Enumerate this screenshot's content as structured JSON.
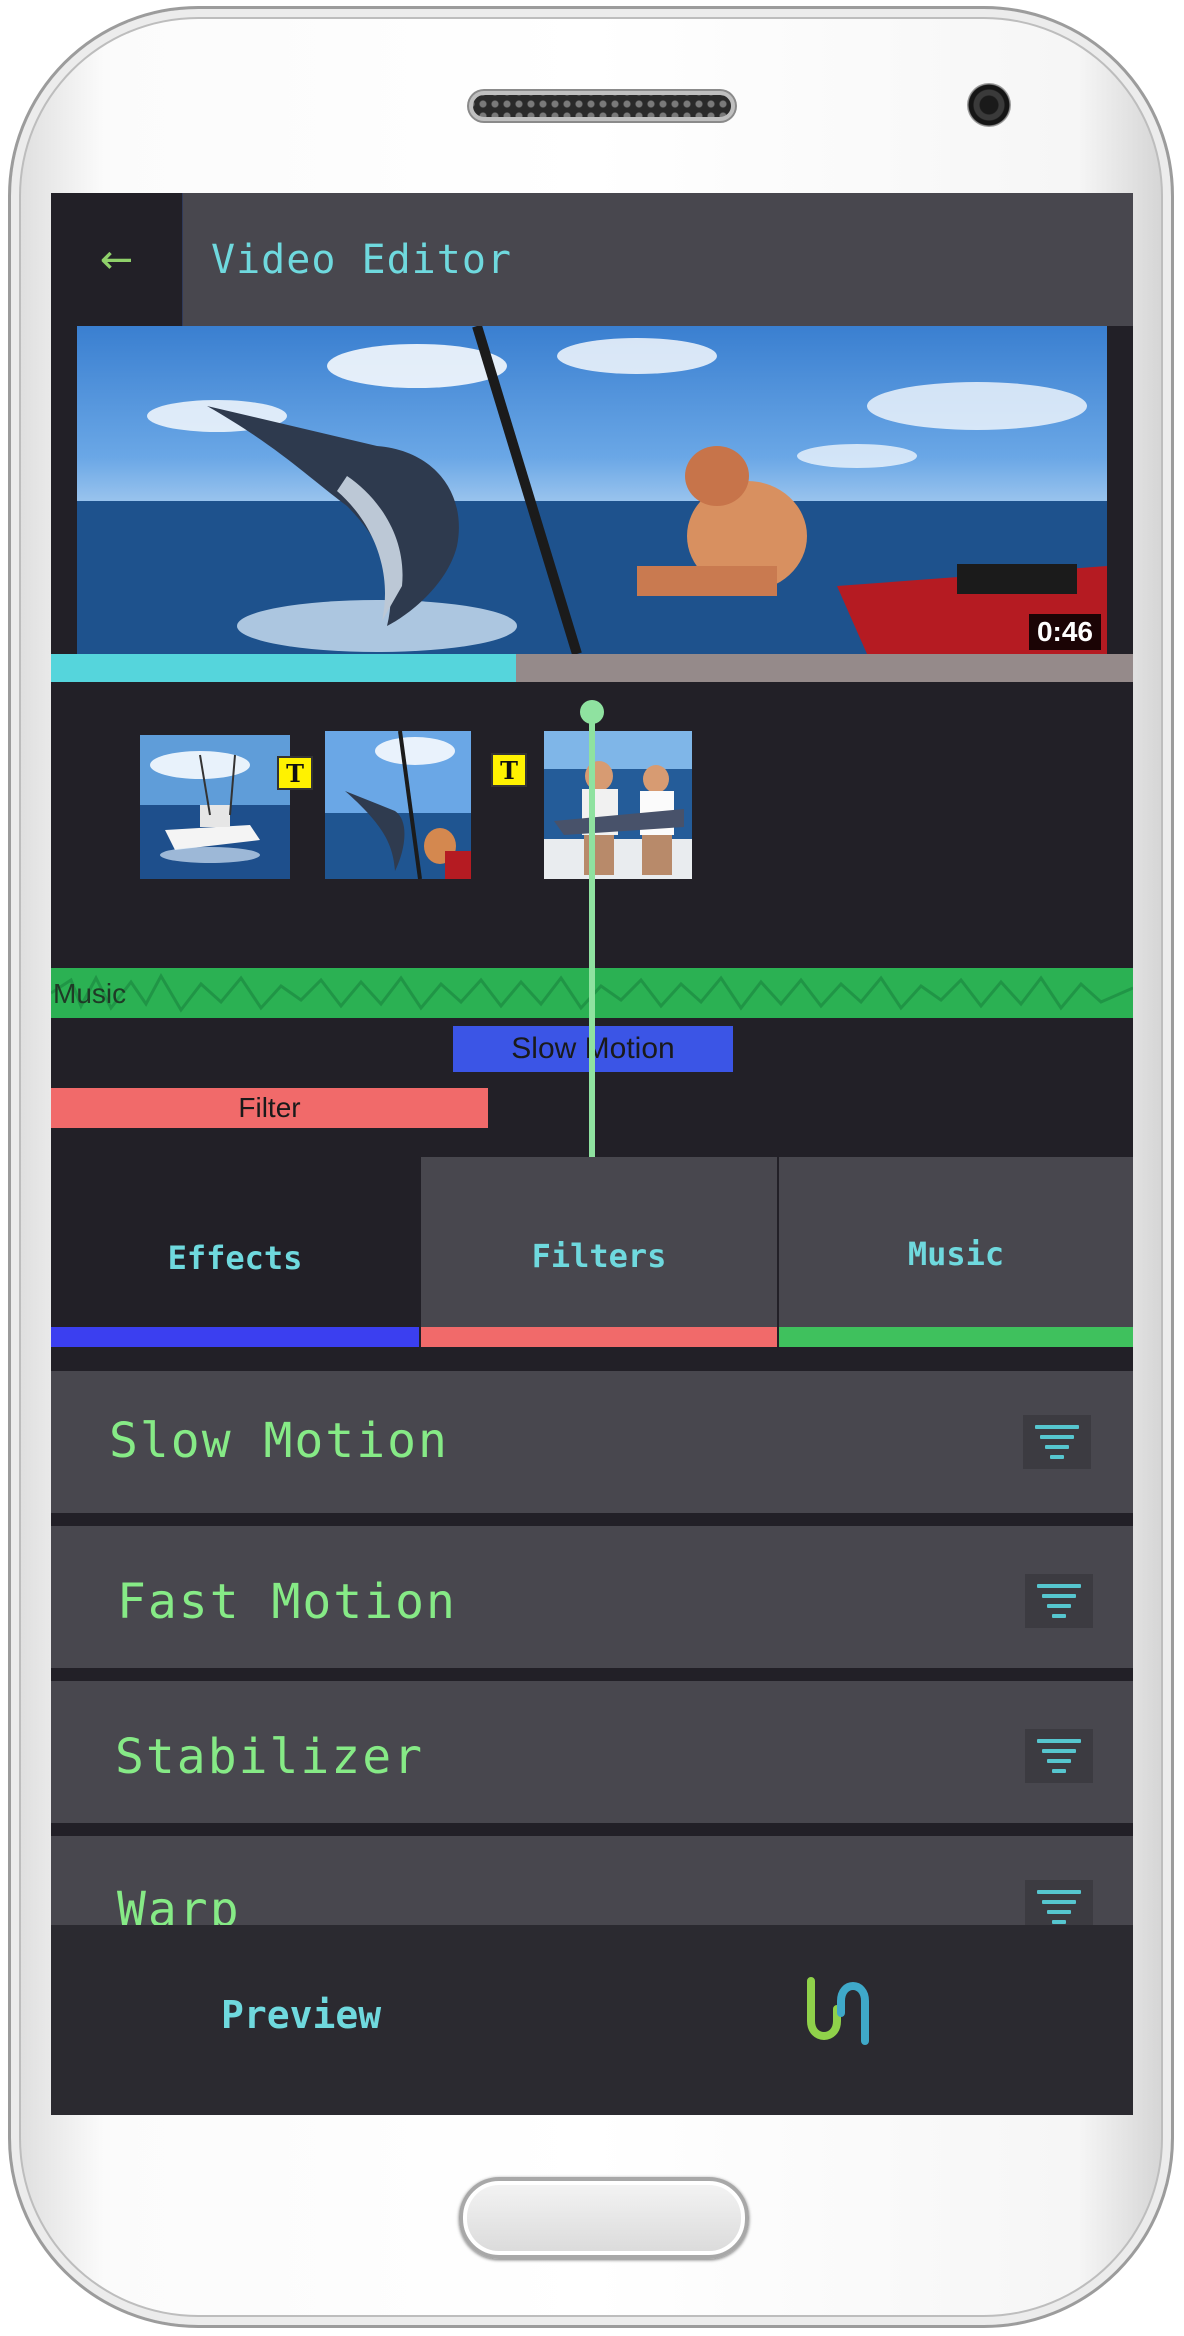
{
  "app": {
    "title": "Video Editor",
    "back_icon": "arrow-left-icon"
  },
  "preview": {
    "duration": "0:46",
    "progress_fraction": 0.43
  },
  "timeline": {
    "clips": [
      {
        "name": "boat-clip",
        "text_badge": "T"
      },
      {
        "name": "marlin-jump-clip",
        "text_badge": "T"
      },
      {
        "name": "marlin-catch-clip"
      }
    ],
    "tracks": {
      "music_label": "Music",
      "slow_motion_label": "Slow Motion",
      "filter_label": "Filter"
    }
  },
  "tabs": [
    {
      "label": "Effects",
      "color": "#3b3ff0",
      "active": true
    },
    {
      "label": "Filters",
      "color": "#f16a6a",
      "active": false
    },
    {
      "label": "Music",
      "color": "#3fc15d",
      "active": false
    }
  ],
  "effects": [
    {
      "label": "Slow Motion",
      "icon": "filter-lines-icon"
    },
    {
      "label": "Fast Motion",
      "icon": "filter-lines-icon"
    },
    {
      "label": "Stabilizer",
      "icon": "filter-lines-icon"
    },
    {
      "label": "Warp",
      "icon": "filter-lines-icon"
    }
  ],
  "bottom": {
    "preview_label": "Preview",
    "logo_icon": "app-logo-icon"
  },
  "colors": {
    "accent_cyan": "#6fd9de",
    "effect_text": "#86ea86",
    "panel": "#48474e",
    "background": "#222027"
  }
}
